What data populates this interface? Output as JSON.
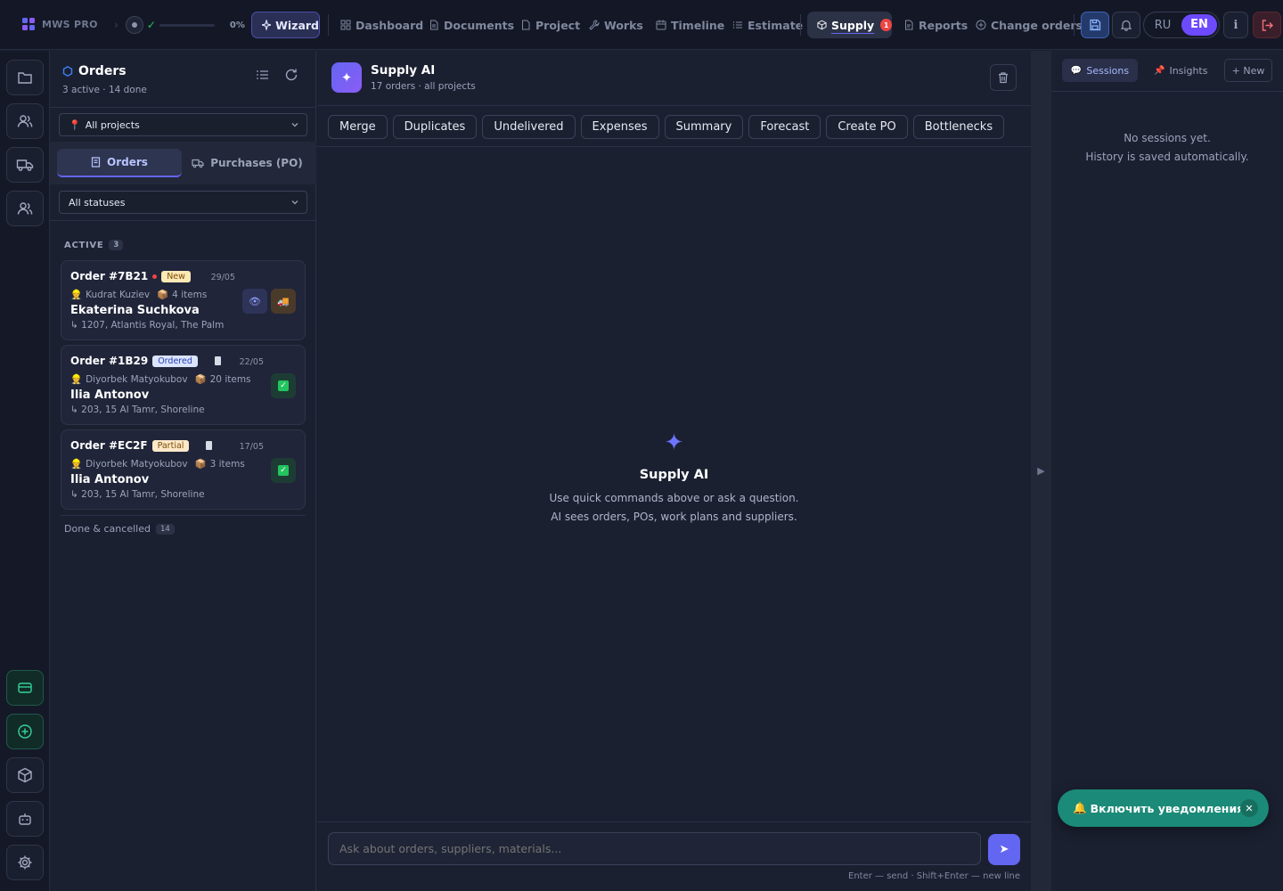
{
  "app": {
    "name": "MWS PRO",
    "progress_pct": "0%",
    "progress_value": 0
  },
  "nav": {
    "wizard": "Wizard",
    "dashboard": "Dashboard",
    "documents": "Documents",
    "project": "Project",
    "works": "Works",
    "timeline": "Timeline",
    "estimate": "Estimate",
    "supply": "Supply",
    "supply_badge": "1",
    "reports": "Reports",
    "change_orders": "Change orders"
  },
  "lang": {
    "ru": "RU",
    "en": "EN",
    "active": "EN"
  },
  "orders_panel": {
    "title": "Orders",
    "subtitle": "3 active · 14 done",
    "project_filter": "All projects",
    "tabs": {
      "orders": "Orders",
      "purchases": "Purchases (PO)"
    },
    "status_filter": "All statuses",
    "active_label": "ACTIVE",
    "active_count": "3",
    "done_label": "Done & cancelled",
    "done_count": "14",
    "cards": [
      {
        "order": "Order #7B21",
        "status": "New",
        "date": "29/05",
        "manager": "Kudrat Kuziev",
        "items": "4 items",
        "client": "Ekaterina Suchkova",
        "address": "1207, Atlantis Royal, The Palm"
      },
      {
        "order": "Order #1B29",
        "status": "Ordered",
        "date": "22/05",
        "manager": "Diyorbek Matyokubov",
        "items": "20 items",
        "client": "Ilia Antonov",
        "address": "203, 15 Al Tamr, Shoreline"
      },
      {
        "order": "Order #EC2F",
        "status": "Partial",
        "date": "17/05",
        "manager": "Diyorbek Matyokubov",
        "items": "3 items",
        "client": "Ilia Antonov",
        "address": "203, 15 Al Tamr, Shoreline"
      }
    ]
  },
  "chat": {
    "title": "Supply AI",
    "subtitle": "17 orders · all projects",
    "commands": [
      "Merge",
      "Duplicates",
      "Undelivered",
      "Expenses",
      "Summary",
      "Forecast",
      "Create PO",
      "Bottlenecks"
    ],
    "empty_title": "Supply AI",
    "empty_line1": "Use quick commands above or ask a question.",
    "empty_line2": "AI sees orders, POs, work plans and suppliers.",
    "input_placeholder": "Ask about orders, suppliers, materials...",
    "hint": "Enter — send · Shift+Enter — new line"
  },
  "sessions_panel": {
    "tab_sessions": "Sessions",
    "tab_insights": "Insights",
    "new": "+ New",
    "empty_line1": "No sessions yet.",
    "empty_line2": "History is saved automatically."
  },
  "toast": {
    "text": "Включить уведомления",
    "icon": "🔔"
  },
  "colors": {
    "accent": "#6366f1",
    "toast": "#1b8a78",
    "danger": "#ef4444",
    "success": "#22c55e"
  }
}
